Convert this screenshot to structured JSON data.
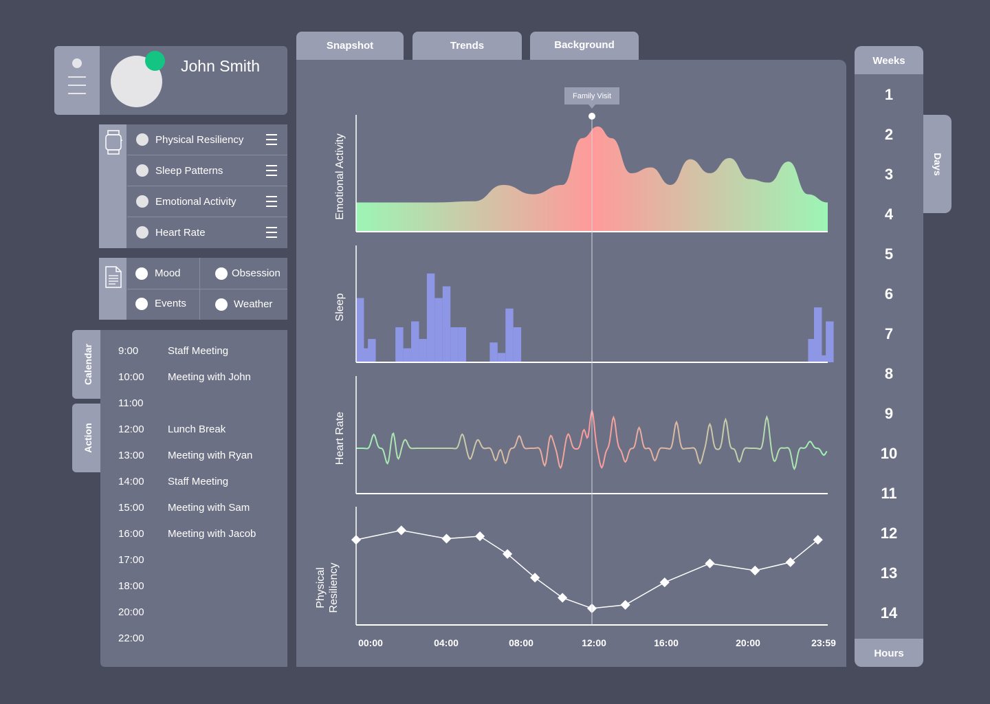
{
  "profile": {
    "name": "John Smith",
    "status_color": "#14c483"
  },
  "icons": {
    "menu": "hamburger-icon",
    "watch": "smartwatch-icon",
    "doc": "document-icon"
  },
  "metrics": [
    {
      "label": "Physical Resiliency"
    },
    {
      "label": "Sleep Patterns"
    },
    {
      "label": "Emotional Activity"
    },
    {
      "label": "Heart Rate"
    }
  ],
  "filters": [
    {
      "label": "Mood"
    },
    {
      "label": "Obsession"
    },
    {
      "label": "Events"
    },
    {
      "label": "Weather"
    }
  ],
  "side_tabs": {
    "calendar": "Calendar",
    "action": "Action"
  },
  "schedule": [
    {
      "time": "9:00",
      "event": "Staff Meeting"
    },
    {
      "time": "10:00",
      "event": "Meeting with John"
    },
    {
      "time": "11:00",
      "event": ""
    },
    {
      "time": "12:00",
      "event": "Lunch Break"
    },
    {
      "time": "13:00",
      "event": "Meeting with Ryan"
    },
    {
      "time": "14:00",
      "event": "Staff Meeting"
    },
    {
      "time": "15:00",
      "event": "Meeting with Sam"
    },
    {
      "time": "16:00",
      "event": "Meeting with Jacob"
    },
    {
      "time": "17:00",
      "event": ""
    },
    {
      "time": "18:00",
      "event": ""
    },
    {
      "time": "20:00",
      "event": ""
    },
    {
      "time": "22:00",
      "event": ""
    }
  ],
  "tabs": [
    {
      "label": "Snapshot"
    },
    {
      "label": "Trends"
    },
    {
      "label": "Background"
    }
  ],
  "weeks": {
    "header": "Weeks",
    "footer": "Hours",
    "days_label": "Days",
    "numbers": [
      "1",
      "2",
      "3",
      "4",
      "5",
      "6",
      "7",
      "8",
      "9",
      "10",
      "11",
      "12",
      "13",
      "14"
    ]
  },
  "chart_data": {
    "type": "line",
    "x_ticks": [
      "00:00",
      "04:00",
      "08:00",
      "12:00",
      "16:00",
      "20:00",
      "23:59"
    ],
    "marker": {
      "label": "Family Visit",
      "x_hour": 12
    },
    "panels": [
      {
        "ylabel": "Emotional Activity",
        "type": "area",
        "x": [
          0,
          4,
          6,
          7.5,
          9,
          10.5,
          11.5,
          12.3,
          13,
          14,
          15,
          16,
          17,
          18,
          19,
          20,
          21,
          22,
          23,
          24
        ],
        "values": [
          0.25,
          0.25,
          0.26,
          0.4,
          0.32,
          0.4,
          0.8,
          0.9,
          0.8,
          0.5,
          0.55,
          0.4,
          0.62,
          0.5,
          0.63,
          0.45,
          0.42,
          0.6,
          0.32,
          0.25
        ],
        "colors": [
          "#9cf5b5",
          "#ff9a9a",
          "#9cf5b5"
        ]
      },
      {
        "ylabel": "Sleep",
        "type": "bar",
        "color": "#8e96e6",
        "x": [
          0,
          0.3,
          0.6,
          0.9,
          2,
          2.4,
          2.8,
          3.2,
          3.6,
          4,
          4.4,
          4.8,
          5.2,
          5.6,
          6.8,
          7.2,
          7.6,
          8,
          23,
          23.3,
          23.6,
          23.9
        ],
        "values": [
          0.55,
          0.12,
          0.2,
          0.0,
          0.3,
          0.12,
          0.35,
          0.2,
          0.76,
          0.55,
          0.65,
          0.3,
          0.3,
          0.0,
          0.17,
          0.08,
          0.46,
          0.3,
          0.2,
          0.47,
          0.06,
          0.35
        ]
      },
      {
        "ylabel": "Heart Rate",
        "type": "line",
        "colors": [
          "#9cf5b5",
          "#ff9a9a",
          "#9cf5b5"
        ]
      },
      {
        "ylabel": "Physical Resiliency",
        "type": "line",
        "color": "#ffffff",
        "x": [
          0,
          2.3,
          4.6,
          6.3,
          7.7,
          9.1,
          10.5,
          12,
          13.7,
          15.7,
          18,
          20.3,
          22.1,
          23.5
        ],
        "values": [
          0.72,
          0.8,
          0.73,
          0.75,
          0.6,
          0.4,
          0.23,
          0.14,
          0.17,
          0.36,
          0.52,
          0.46,
          0.53,
          0.72
        ]
      }
    ]
  }
}
